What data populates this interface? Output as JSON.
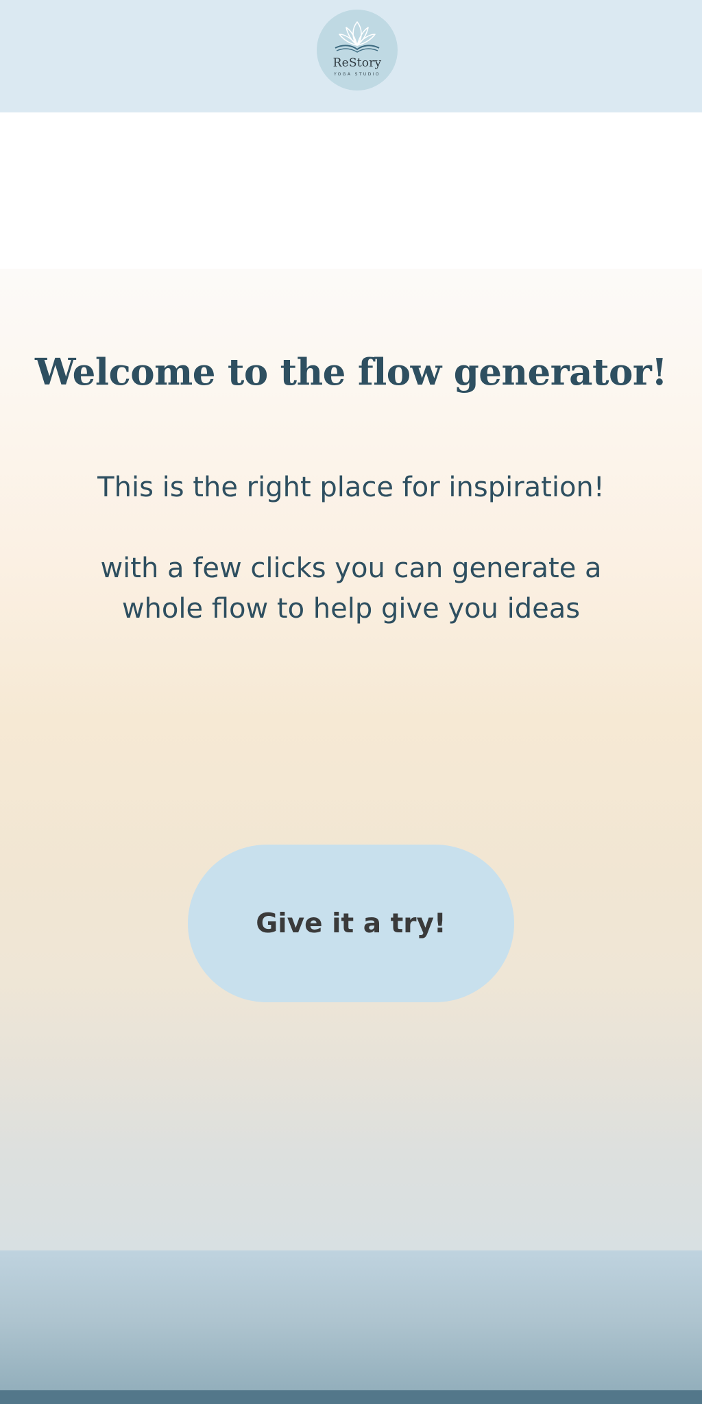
{
  "header": {
    "logo": {
      "icon": "lotus-book-icon",
      "name": "ReStory",
      "tagline": "YOGA STUDIO"
    }
  },
  "hero": {
    "title": "Welcome to the flow generator!",
    "intro": "This is the right place for inspiration!",
    "description": "with a few clicks you can generate a whole flow to help give you ideas",
    "cta_label": "Give it a try!"
  },
  "colors": {
    "header_bg": "#dbe9f2",
    "text": "#2e4f60",
    "button_bg": "#c8e0ed",
    "button_text": "#3a3a3a",
    "footer_strip": "#53778a"
  }
}
